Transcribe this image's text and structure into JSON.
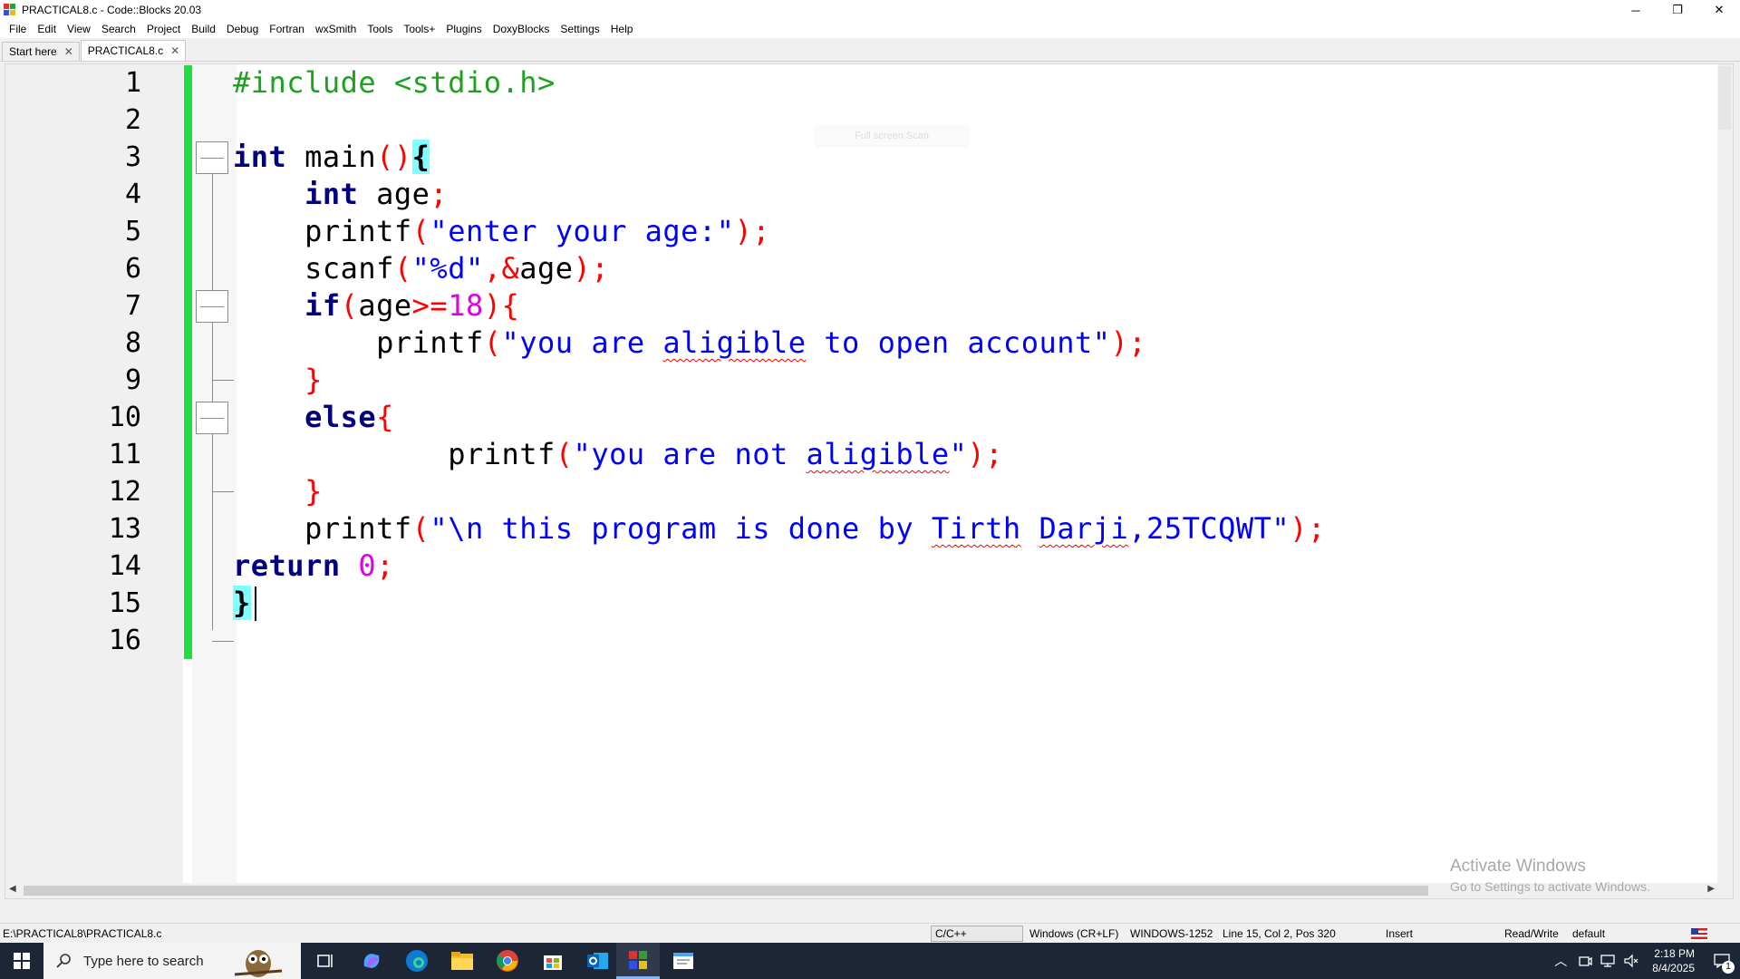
{
  "window": {
    "title": "PRACTICAL8.c - Code::Blocks 20.03",
    "controls": {
      "minimize": "─",
      "restore": "❐",
      "close": "✕"
    }
  },
  "menu": [
    "File",
    "Edit",
    "View",
    "Search",
    "Project",
    "Build",
    "Debug",
    "Fortran",
    "wxSmith",
    "Tools",
    "Tools+",
    "Plugins",
    "DoxyBlocks",
    "Settings",
    "Help"
  ],
  "tabs": [
    {
      "label": "Start here",
      "close": "✕"
    },
    {
      "label": "PRACTICAL8.c",
      "close": "✕"
    }
  ],
  "editor": {
    "line_numbers": [
      "1",
      "2",
      "3",
      "4",
      "5",
      "6",
      "7",
      "8",
      "9",
      "10",
      "11",
      "12",
      "13",
      "14",
      "15",
      "16"
    ],
    "ghost_tooltip": "Full screen Scan",
    "code": {
      "l1": {
        "directive": "#include <stdio.h>"
      },
      "l3": {
        "kw": "int",
        "name": " main",
        "paren": "()",
        "brace": "{"
      },
      "l4": {
        "indent": "    ",
        "kw": "int",
        "name": " age",
        "semi": ";"
      },
      "l5": {
        "indent": "    ",
        "fn": "printf",
        "open": "(",
        "str": "\"enter your age:\"",
        "close": ");"
      },
      "l6": {
        "indent": "    ",
        "fn": "scanf",
        "open": "(",
        "str": "\"%d\"",
        "comma": ",&",
        "var": "age",
        "close": ");"
      },
      "l7": {
        "indent": "    ",
        "kw": "if",
        "open": "(",
        "var": "age",
        "op": ">=",
        "num": "18",
        "close": "){"
      },
      "l8": {
        "indent": "        ",
        "fn": "printf",
        "open": "(",
        "str_a": "\"you are ",
        "str_b": "aligible",
        "str_c": " to open account\"",
        "close": ");"
      },
      "l9": {
        "indent": "    ",
        "brace": "}"
      },
      "l10": {
        "indent": "    ",
        "kw": "else",
        "brace": "{"
      },
      "l11": {
        "indent": "            ",
        "fn": "printf",
        "open": "(",
        "str_a": "\"you are not ",
        "str_b": "aligible",
        "str_c": "\"",
        "close": ");"
      },
      "l12": {
        "indent": "    ",
        "brace": "}"
      },
      "l13": {
        "indent": "    ",
        "fn": "printf",
        "open": "(",
        "str_a": "\"\\n this program is done by ",
        "str_b": "Tirth",
        "str_c": " ",
        "str_d": "Darji",
        "str_e": ",25TCQWT\"",
        "close": ");"
      },
      "l14": {
        "kw": "return",
        "num": " 0",
        "semi": ";"
      },
      "l15": {
        "brace": "}"
      }
    }
  },
  "watermark": {
    "title": "Activate Windows",
    "subtitle": "Go to Settings to activate Windows."
  },
  "statusbar": {
    "path": "E:\\PRACTICAL8\\PRACTICAL8.c",
    "language": "C/C++",
    "line_endings": "Windows (CR+LF)",
    "encoding": "WINDOWS-1252",
    "position": "Line 15, Col 2, Pos 320",
    "mode": "Insert",
    "access": "Read/Write",
    "profile": "default"
  },
  "taskbar": {
    "search_placeholder": "Type here to search",
    "time": "2:18 PM",
    "date": "8/4/2025",
    "notification_count": "1",
    "apps": [
      "task-view",
      "copilot",
      "edge",
      "file-explorer",
      "chrome",
      "microsoft-store",
      "outlook",
      "codeblocks",
      "notepad"
    ]
  },
  "colors": {
    "change_bar": "#22dd44",
    "keyword": "#000080",
    "string": "#0000ff",
    "number": "#e000e0",
    "operator": "#ff0000",
    "preprocessor": "#20a020",
    "brace_highlight": "#80ffff",
    "taskbar": "#1c2636"
  }
}
